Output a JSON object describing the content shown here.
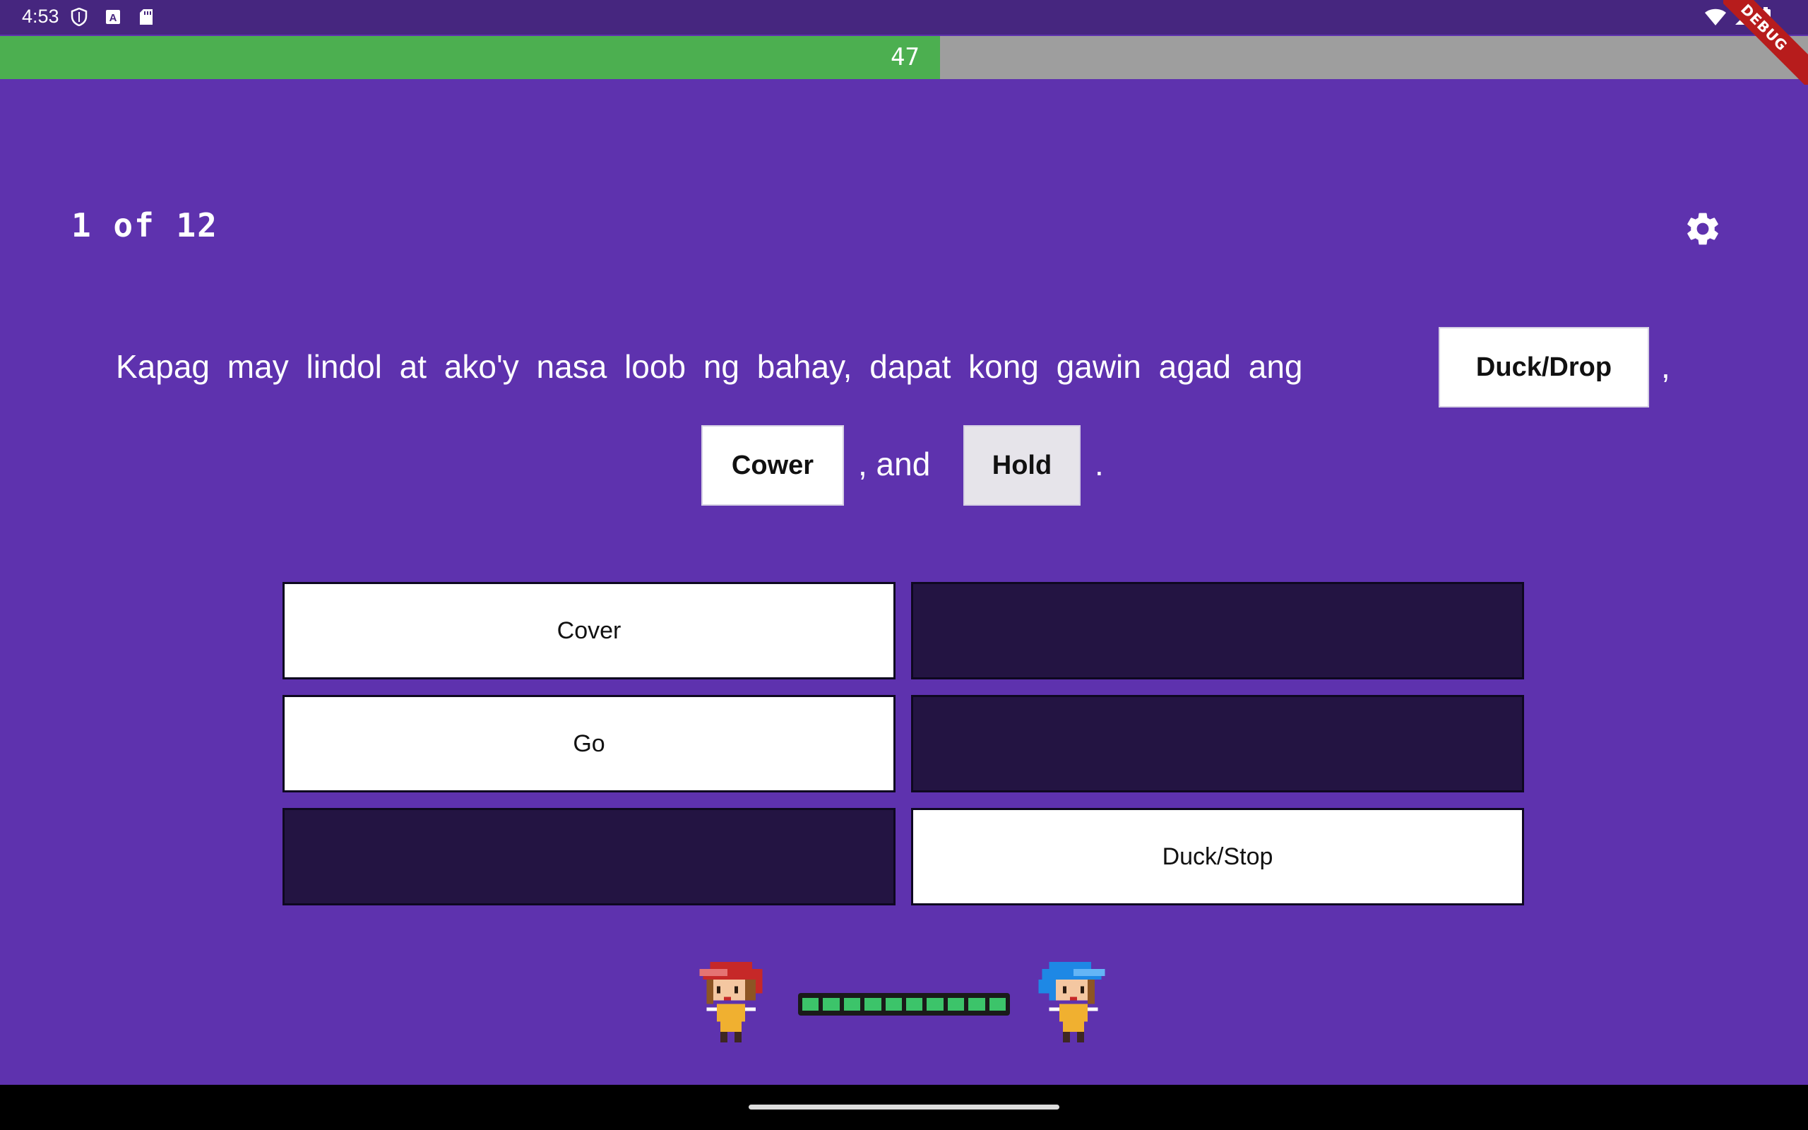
{
  "status_bar": {
    "time": "4:53",
    "icons": [
      "shield-icon",
      "a-icon",
      "sdcard-icon",
      "wifi-icon",
      "signal-icon",
      "battery-icon"
    ]
  },
  "debug_banner": "DEBUG",
  "progress": {
    "value": 47,
    "fraction": 0.52,
    "fill_color": "#4caf50",
    "track_color": "#9e9e9e"
  },
  "counter": "1 of 12",
  "question": {
    "line1": "Kapag may lindol at ako'y nasa loob ng bahay, dapat kong gawin agad ang",
    "sep1": ",",
    "sep2": ", and",
    "end": ".",
    "blanks": [
      "Duck/Drop",
      "Cower",
      "Hold"
    ]
  },
  "options": [
    {
      "label": "Cover",
      "state": "filled"
    },
    {
      "label": "",
      "state": "empty"
    },
    {
      "label": "Go",
      "state": "filled"
    },
    {
      "label": "",
      "state": "empty"
    },
    {
      "label": "",
      "state": "empty"
    },
    {
      "label": "Duck/Stop",
      "state": "filled"
    }
  ],
  "battle": {
    "player": "red-hair-character",
    "opponent": "blue-hair-character",
    "health_segments": 10,
    "health_color": "#3cc46a"
  },
  "colors": {
    "background": "#5e32ae",
    "status_bar": "#46267f",
    "empty_slot": "#231442"
  }
}
